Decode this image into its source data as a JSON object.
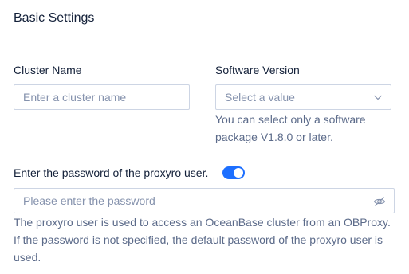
{
  "header": {
    "title": "Basic Settings"
  },
  "cluster_name": {
    "label": "Cluster Name",
    "placeholder": "Enter a cluster name"
  },
  "software_version": {
    "label": "Software Version",
    "placeholder": "Select a value",
    "help": "You can select only a software package V1.8.0 or later."
  },
  "proxyro": {
    "label": "Enter the password of the proxyro user.",
    "toggle_on": true,
    "placeholder": "Please enter the password",
    "help": "The proxyro user is used to access an OceanBase cluster from an OBProxy. If the password is not specified, the default password of the proxyro user is used."
  },
  "colors": {
    "accent": "#1d6fff",
    "text": "#132039",
    "muted": "#5c6b8a",
    "placeholder": "#8592ad",
    "border": "#cdd5e4"
  },
  "icons": {
    "select_arrow": "chevron-down-icon",
    "password_visibility": "eye-invisible-icon"
  }
}
